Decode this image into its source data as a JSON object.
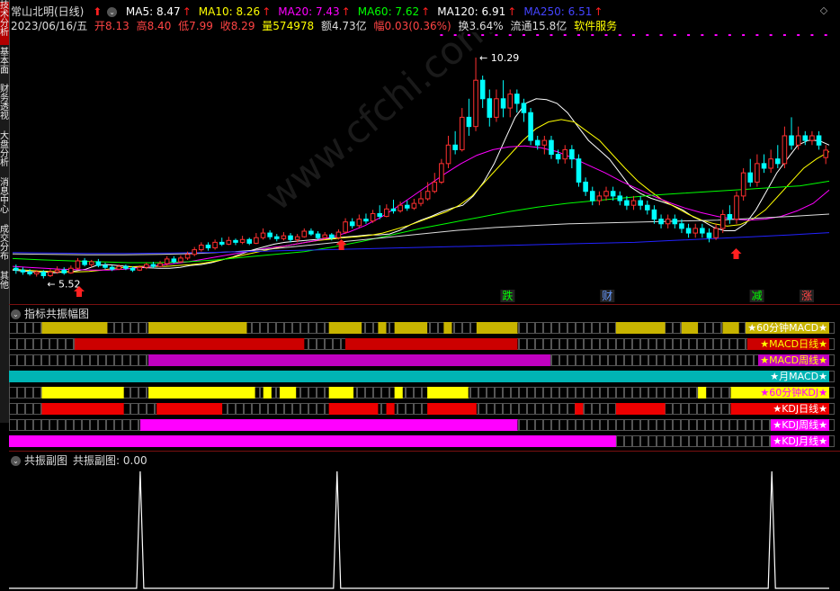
{
  "sidebar": {
    "tabs": [
      {
        "label": "技术分析",
        "active": true
      },
      {
        "label": "基本面"
      },
      {
        "label": "财务透视"
      },
      {
        "label": "大盘分析"
      },
      {
        "label": "消息中心"
      },
      {
        "label": "成交分布"
      },
      {
        "label": "其他"
      }
    ]
  },
  "header": {
    "stock_name": "常山北明(日线)",
    "ma": [
      {
        "label": "MA5: 8.47",
        "color": "#ffffff"
      },
      {
        "label": "MA10: 8.26",
        "color": "#ffff00"
      },
      {
        "label": "MA20: 7.43",
        "color": "#ff00ff"
      },
      {
        "label": "MA60: 7.62",
        "color": "#00ff00"
      },
      {
        "label": "MA120: 6.91",
        "color": "#ffffff"
      },
      {
        "label": "MA250: 6.51",
        "color": "#4444ff"
      }
    ],
    "date": "2023/06/16/五",
    "open": "开8.13",
    "high": "高8.40",
    "low": "低7.99",
    "close": "收8.29",
    "volume": "量574978",
    "amount": "额4.73亿",
    "change": "幅0.03(0.36%)",
    "turnover": "换3.64%",
    "float_value": "流通15.8亿",
    "sector": "软件服务"
  },
  "annotations": {
    "high_label": "10.29",
    "low_label": "5.52",
    "markers": [
      {
        "text": "跌",
        "color": "#00ff00"
      },
      {
        "text": "财",
        "color": "#6699ff"
      },
      {
        "text": "减",
        "color": "#00ff00"
      },
      {
        "text": "涨",
        "color": "#ff4444"
      }
    ]
  },
  "resonance_panel": {
    "title": "指标共振幅图",
    "rows": [
      {
        "label": "★60分钟MACD★",
        "color": "#c8b400",
        "label_color": "#ffffff"
      },
      {
        "label": "★MACD日线★",
        "color": "#cc0000",
        "label_color": "#ffff00"
      },
      {
        "label": "★MACD周线★",
        "color": "#c000c0",
        "label_color": "#ffff00"
      },
      {
        "label": "★月MACD★",
        "color": "#00b4b4",
        "label_color": "#ffffff"
      },
      {
        "label": "★60分钟KDJ★",
        "color": "#ffff00",
        "label_color": "#ff00ff"
      },
      {
        "label": "★KDJ日线★",
        "color": "#ee0000",
        "label_color": "#ffffff"
      },
      {
        "label": "★KDJ周线★",
        "color": "#ff00ff",
        "label_color": "#ffffff"
      },
      {
        "label": "★KDJ月线★",
        "color": "#ff00ff",
        "label_color": "#ffffff"
      }
    ]
  },
  "sub_panel": {
    "title": "共振副图",
    "value_text": "共振副图: 0.00"
  },
  "chart_data": {
    "type": "candlestick",
    "ma_lines": [
      "MA5",
      "MA10",
      "MA20",
      "MA60",
      "MA120",
      "MA250"
    ],
    "ylim": [
      5.2,
      10.6
    ],
    "candles": [
      [
        5.74,
        5.7,
        5.82,
        5.62
      ],
      [
        5.7,
        5.66,
        5.76,
        5.6
      ],
      [
        5.66,
        5.62,
        5.72,
        5.58
      ],
      [
        5.62,
        5.66,
        5.7,
        5.56
      ],
      [
        5.66,
        5.58,
        5.7,
        5.52
      ],
      [
        5.58,
        5.66,
        5.72,
        5.55
      ],
      [
        5.66,
        5.7,
        5.78,
        5.62
      ],
      [
        5.7,
        5.64,
        5.76,
        5.6
      ],
      [
        5.64,
        5.74,
        5.8,
        5.62
      ],
      [
        5.74,
        5.9,
        5.96,
        5.7
      ],
      [
        5.9,
        5.82,
        5.96,
        5.78
      ],
      [
        5.82,
        5.88,
        5.92,
        5.76
      ],
      [
        5.88,
        5.8,
        5.94,
        5.76
      ],
      [
        5.8,
        5.76,
        5.86,
        5.72
      ],
      [
        5.76,
        5.72,
        5.8,
        5.68
      ],
      [
        5.72,
        5.78,
        5.82,
        5.7
      ],
      [
        5.78,
        5.74,
        5.82,
        5.7
      ],
      [
        5.74,
        5.7,
        5.78,
        5.66
      ],
      [
        5.7,
        5.76,
        5.8,
        5.68
      ],
      [
        5.76,
        5.82,
        5.86,
        5.72
      ],
      [
        5.82,
        5.78,
        5.88,
        5.74
      ],
      [
        5.78,
        5.84,
        5.9,
        5.76
      ],
      [
        5.84,
        5.94,
        6.0,
        5.8
      ],
      [
        5.94,
        5.88,
        6.0,
        5.84
      ],
      [
        5.88,
        5.96,
        6.02,
        5.86
      ],
      [
        5.96,
        6.04,
        6.1,
        5.92
      ],
      [
        6.04,
        6.14,
        6.2,
        6.0
      ],
      [
        6.14,
        6.24,
        6.3,
        6.1
      ],
      [
        6.24,
        6.18,
        6.3,
        6.12
      ],
      [
        6.18,
        6.3,
        6.36,
        6.14
      ],
      [
        6.3,
        6.26,
        6.4,
        6.22
      ],
      [
        6.26,
        6.34,
        6.42,
        6.24
      ],
      [
        6.34,
        6.3,
        6.38,
        6.24
      ],
      [
        6.3,
        6.36,
        6.44,
        6.26
      ],
      [
        6.36,
        6.28,
        6.4,
        6.24
      ],
      [
        6.28,
        6.4,
        6.5,
        6.26
      ],
      [
        6.4,
        6.5,
        6.6,
        6.36
      ],
      [
        6.5,
        6.42,
        6.56,
        6.36
      ],
      [
        6.42,
        6.38,
        6.48,
        6.32
      ],
      [
        6.38,
        6.44,
        6.52,
        6.34
      ],
      [
        6.44,
        6.36,
        6.5,
        6.3
      ],
      [
        6.36,
        6.42,
        6.48,
        6.3
      ],
      [
        6.42,
        6.54,
        6.6,
        6.4
      ],
      [
        6.54,
        6.48,
        6.6,
        6.44
      ],
      [
        6.48,
        6.4,
        6.54,
        6.36
      ],
      [
        6.4,
        6.46,
        6.52,
        6.36
      ],
      [
        6.46,
        6.4,
        6.5,
        6.34
      ],
      [
        6.4,
        6.52,
        6.58,
        6.36
      ],
      [
        6.52,
        6.74,
        6.82,
        6.48
      ],
      [
        6.74,
        6.66,
        6.82,
        6.6
      ],
      [
        6.66,
        6.8,
        6.9,
        6.62
      ],
      [
        6.8,
        6.76,
        6.92,
        6.7
      ],
      [
        6.76,
        6.92,
        7.0,
        6.72
      ],
      [
        6.92,
        6.86,
        7.1,
        6.8
      ],
      [
        6.86,
        7.02,
        7.12,
        6.84
      ],
      [
        7.02,
        6.98,
        7.22,
        6.92
      ],
      [
        6.98,
        7.1,
        7.18,
        6.94
      ],
      [
        7.1,
        7.04,
        7.2,
        6.98
      ],
      [
        7.04,
        7.14,
        7.24,
        7.0
      ],
      [
        7.14,
        7.24,
        7.4,
        7.08
      ],
      [
        7.24,
        7.4,
        7.6,
        7.2
      ],
      [
        7.4,
        7.6,
        7.8,
        7.36
      ],
      [
        7.6,
        8.0,
        8.1,
        7.56
      ],
      [
        8.0,
        8.4,
        8.6,
        7.9
      ],
      [
        8.4,
        8.3,
        8.7,
        8.2
      ],
      [
        8.3,
        9.0,
        9.2,
        8.26
      ],
      [
        9.0,
        8.8,
        9.4,
        8.6
      ],
      [
        8.8,
        9.8,
        10.29,
        8.7
      ],
      [
        9.8,
        9.4,
        9.9,
        9.2
      ],
      [
        9.4,
        9.0,
        9.6,
        8.8
      ],
      [
        9.0,
        9.4,
        9.6,
        8.9
      ],
      [
        9.4,
        9.2,
        9.8,
        9.0
      ],
      [
        9.2,
        9.5,
        9.6,
        9.0
      ],
      [
        9.5,
        9.3,
        9.6,
        9.1
      ],
      [
        9.3,
        9.1,
        9.4,
        8.9
      ],
      [
        9.1,
        8.5,
        9.2,
        8.4
      ],
      [
        8.5,
        8.4,
        8.6,
        8.3
      ],
      [
        8.4,
        8.5,
        8.6,
        8.2
      ],
      [
        8.5,
        8.2,
        8.6,
        8.1
      ],
      [
        8.2,
        8.1,
        8.3,
        8.0
      ],
      [
        8.1,
        8.3,
        8.4,
        8.0
      ],
      [
        8.3,
        8.1,
        8.4,
        7.9
      ],
      [
        8.1,
        7.6,
        8.2,
        7.5
      ],
      [
        7.6,
        7.4,
        7.7,
        7.3
      ],
      [
        7.4,
        7.2,
        7.5,
        7.1
      ],
      [
        7.2,
        7.3,
        7.4,
        7.1
      ],
      [
        7.3,
        7.4,
        7.5,
        7.2
      ],
      [
        7.4,
        7.3,
        7.5,
        7.2
      ],
      [
        7.3,
        7.2,
        7.4,
        7.1
      ],
      [
        7.2,
        7.1,
        7.3,
        7.0
      ],
      [
        7.1,
        7.2,
        7.3,
        7.0
      ],
      [
        7.2,
        7.1,
        7.3,
        7.0
      ],
      [
        7.1,
        7.0,
        7.2,
        6.9
      ],
      [
        7.0,
        6.8,
        7.1,
        6.7
      ],
      [
        6.8,
        6.7,
        6.9,
        6.6
      ],
      [
        6.7,
        6.8,
        6.9,
        6.6
      ],
      [
        6.8,
        6.7,
        6.9,
        6.6
      ],
      [
        6.7,
        6.6,
        6.8,
        6.5
      ],
      [
        6.6,
        6.5,
        6.7,
        6.4
      ],
      [
        6.5,
        6.6,
        6.7,
        6.4
      ],
      [
        6.6,
        6.5,
        6.7,
        6.4
      ],
      [
        6.5,
        6.4,
        6.6,
        6.3
      ],
      [
        6.4,
        6.6,
        6.7,
        6.35
      ],
      [
        6.6,
        6.9,
        7.0,
        6.5
      ],
      [
        6.9,
        6.8,
        7.1,
        6.7
      ],
      [
        6.8,
        7.3,
        7.4,
        6.7
      ],
      [
        7.3,
        7.8,
        7.9,
        7.2
      ],
      [
        7.8,
        7.6,
        8.1,
        7.5
      ],
      [
        7.6,
        8.0,
        8.2,
        7.5
      ],
      [
        8.0,
        7.9,
        8.2,
        7.8
      ],
      [
        7.9,
        8.1,
        8.3,
        7.8
      ],
      [
        8.1,
        8.0,
        8.4,
        7.9
      ],
      [
        8.0,
        8.6,
        8.8,
        7.9
      ],
      [
        8.6,
        8.4,
        9.0,
        8.3
      ],
      [
        8.4,
        8.6,
        8.8,
        8.3
      ],
      [
        8.6,
        8.5,
        8.7,
        8.4
      ],
      [
        8.5,
        8.6,
        8.7,
        8.4
      ],
      [
        8.6,
        8.4,
        8.7,
        8.3
      ],
      [
        8.13,
        8.29,
        8.4,
        7.99
      ]
    ],
    "series": [
      {
        "name": "MA5",
        "values": [
          5.7,
          5.68,
          5.66,
          5.66,
          5.64,
          5.66,
          5.68,
          5.72,
          5.8,
          5.82,
          5.8,
          5.78,
          5.76,
          5.75,
          5.74,
          5.74,
          5.76,
          5.8,
          5.82,
          5.86,
          5.92,
          5.98,
          6.06,
          6.14,
          6.2,
          6.26,
          6.3,
          6.32,
          6.34,
          6.36,
          6.38,
          6.4,
          6.42,
          6.44,
          6.46,
          6.46,
          6.48,
          6.56,
          6.68,
          6.78,
          6.86,
          6.96,
          7.04,
          7.1,
          7.3,
          7.6,
          8.0,
          8.5,
          9.0,
          9.3,
          9.4,
          9.38,
          9.3,
          9.1,
          8.8,
          8.5,
          8.3,
          8.1,
          7.8,
          7.5,
          7.35,
          7.25,
          7.18,
          7.1,
          7.0,
          6.85,
          6.75,
          6.62,
          6.55,
          6.55,
          6.7,
          7.0,
          7.4,
          7.8,
          8.1,
          8.4,
          8.5,
          8.5,
          8.4
        ]
      },
      {
        "name": "MA10",
        "values": [
          5.72,
          5.7,
          5.68,
          5.67,
          5.66,
          5.66,
          5.67,
          5.7,
          5.74,
          5.77,
          5.78,
          5.78,
          5.78,
          5.8,
          5.82,
          5.85,
          5.9,
          5.96,
          6.02,
          6.08,
          6.14,
          6.2,
          6.25,
          6.3,
          6.34,
          6.37,
          6.4,
          6.42,
          6.45,
          6.5,
          6.58,
          6.66,
          6.76,
          6.86,
          6.96,
          7.1,
          7.3,
          7.6,
          7.9,
          8.2,
          8.5,
          8.75,
          8.9,
          8.95,
          8.9,
          8.7,
          8.5,
          8.2,
          7.9,
          7.62,
          7.4,
          7.2,
          7.05,
          6.9,
          6.78,
          6.7,
          6.65,
          6.68,
          6.8,
          7.0,
          7.3,
          7.6,
          7.9,
          8.1,
          8.26
        ]
      },
      {
        "name": "MA20",
        "values": [
          5.78,
          5.76,
          5.74,
          5.72,
          5.71,
          5.7,
          5.7,
          5.72,
          5.76,
          5.8,
          5.84,
          5.88,
          5.94,
          6.0,
          6.06,
          6.12,
          6.18,
          6.22,
          6.28,
          6.34,
          6.42,
          6.52,
          6.66,
          6.84,
          7.06,
          7.3,
          7.54,
          7.78,
          8.0,
          8.18,
          8.3,
          8.36,
          8.38,
          8.34,
          8.26,
          8.12,
          7.96,
          7.8,
          7.62,
          7.46,
          7.3,
          7.16,
          7.04,
          6.94,
          6.86,
          6.8,
          6.78,
          6.8,
          6.86,
          6.98,
          7.14,
          7.43
        ]
      },
      {
        "name": "MA60",
        "values": [
          5.95,
          5.92,
          5.9,
          5.88,
          5.86,
          5.86,
          5.88,
          5.92,
          5.98,
          6.04,
          6.1,
          6.2,
          6.32,
          6.46,
          6.6,
          6.72,
          6.84,
          6.96,
          7.06,
          7.14,
          7.2,
          7.26,
          7.32,
          7.36,
          7.4,
          7.44,
          7.48,
          7.52,
          7.62
        ]
      },
      {
        "name": "MA120",
        "values": [
          6.05,
          6.04,
          6.03,
          6.03,
          6.04,
          6.06,
          6.1,
          6.16,
          6.24,
          6.32,
          6.4,
          6.48,
          6.56,
          6.62,
          6.66,
          6.7,
          6.72,
          6.74,
          6.76,
          6.78,
          6.82,
          6.86,
          6.91
        ]
      },
      {
        "name": "MA250",
        "values": [
          6.08,
          6.07,
          6.06,
          6.06,
          6.07,
          6.08,
          6.1,
          6.12,
          6.14,
          6.16,
          6.18,
          6.2,
          6.22,
          6.24,
          6.26,
          6.28,
          6.3,
          6.34,
          6.38,
          6.42,
          6.46,
          6.51
        ]
      }
    ],
    "resonance_segments": [
      [
        [
          0.04,
          0.12
        ],
        [
          0.17,
          0.29
        ],
        [
          0.39,
          0.43
        ],
        [
          0.45,
          0.46
        ],
        [
          0.47,
          0.51
        ],
        [
          0.53,
          0.54
        ],
        [
          0.57,
          0.62
        ],
        [
          0.74,
          0.8
        ],
        [
          0.82,
          0.84
        ],
        [
          0.87,
          0.89
        ]
      ],
      [
        [
          0.08,
          0.36
        ],
        [
          0.41,
          0.62
        ],
        [
          0.9,
          1.0
        ]
      ],
      [
        [
          0.17,
          0.66
        ]
      ],
      [
        [
          0.0,
          1.0
        ]
      ],
      [
        [
          0.04,
          0.14
        ],
        [
          0.17,
          0.3
        ],
        [
          0.31,
          0.32
        ],
        [
          0.33,
          0.35
        ],
        [
          0.39,
          0.42
        ],
        [
          0.47,
          0.48
        ],
        [
          0.51,
          0.56
        ],
        [
          0.84,
          0.85
        ],
        [
          0.88,
          0.98
        ]
      ],
      [
        [
          0.04,
          0.14
        ],
        [
          0.18,
          0.26
        ],
        [
          0.39,
          0.45
        ],
        [
          0.46,
          0.47
        ],
        [
          0.51,
          0.57
        ],
        [
          0.69,
          0.7
        ],
        [
          0.74,
          0.8
        ],
        [
          0.88,
          0.98
        ]
      ],
      [
        [
          0.16,
          0.62
        ]
      ],
      [
        [
          0.0,
          0.74
        ]
      ]
    ],
    "sub_peaks": [
      0.16,
      0.4,
      0.93
    ]
  }
}
